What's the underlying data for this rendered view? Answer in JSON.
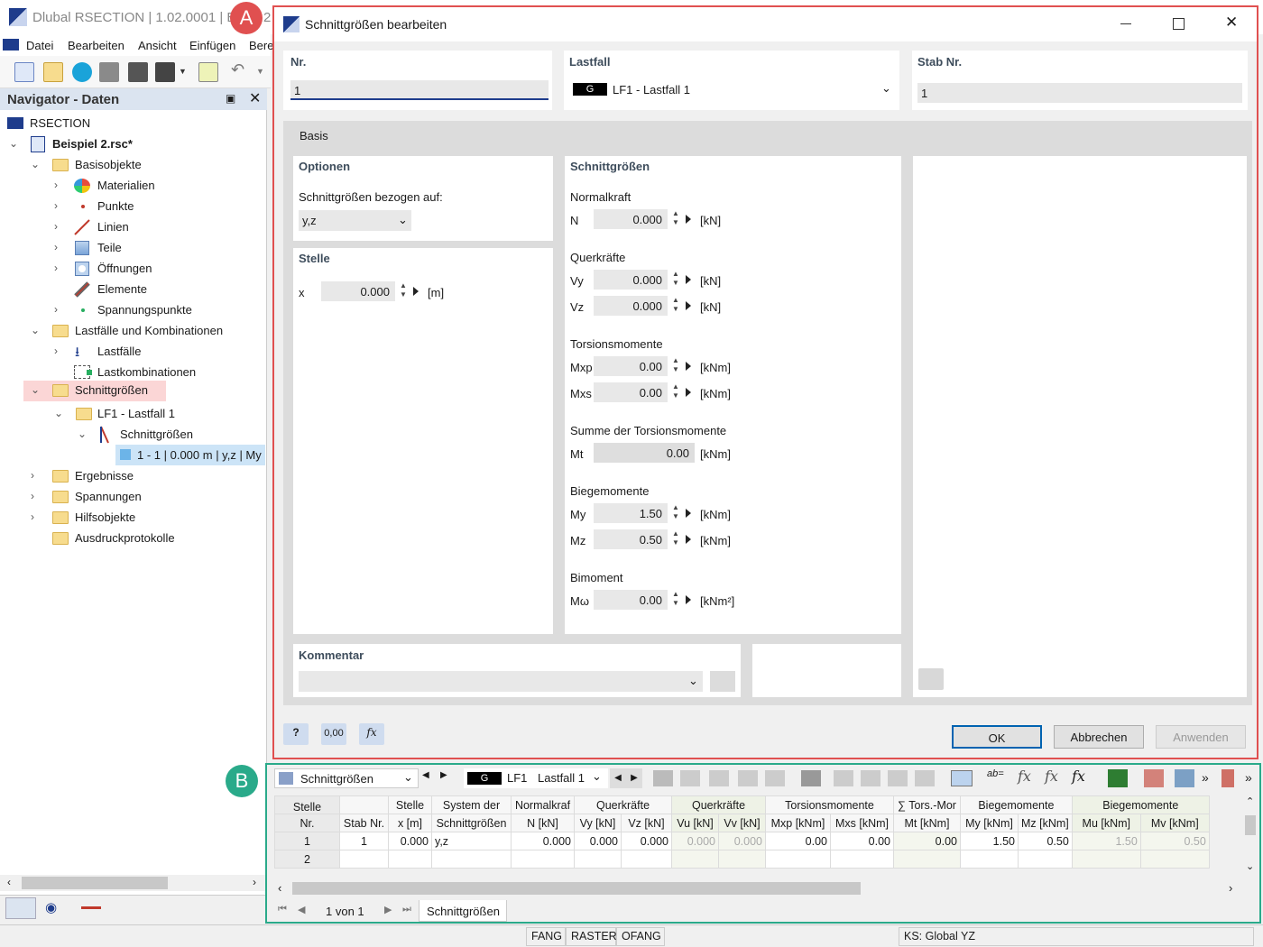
{
  "app": {
    "title": "Dlubal RSECTION | 1.02.0001 | Be",
    "title_suffix": "2"
  },
  "menu": [
    "Datei",
    "Bearbeiten",
    "Ansicht",
    "Einfügen",
    "Bere"
  ],
  "navigator": {
    "title": "Navigator - Daten",
    "root": "RSECTION",
    "file": "Beispiel 2.rsc*",
    "items": {
      "basisobjekte": "Basisobjekte",
      "materialien": "Materialien",
      "punkte": "Punkte",
      "linien": "Linien",
      "teile": "Teile",
      "oeffnungen": "Öffnungen",
      "elemente": "Elemente",
      "spannungspunkte": "Spannungspunkte",
      "lastfaelle_komb": "Lastfälle und Kombinationen",
      "lastfaelle": "Lastfälle",
      "lastkombinationen": "Lastkombinationen",
      "schnittgroessen": "Schnittgrößen",
      "lf1": "LF1 - Lastfall 1",
      "schnittgroessen_sub": "Schnittgrößen",
      "entry": "1 - 1 | 0.000 m | y,z | My",
      "ergebnisse": "Ergebnisse",
      "spannungen": "Spannungen",
      "hilfsobjekte": "Hilfsobjekte",
      "ausdruck": "Ausdruckprotokolle"
    }
  },
  "dialog": {
    "title": "Schnittgrößen bearbeiten",
    "nr_label": "Nr.",
    "nr_value": "1",
    "lastfall_label": "Lastfall",
    "lastfall_badge": "G",
    "lastfall_value": "LF1 - Lastfall 1",
    "stab_label": "Stab Nr.",
    "stab_value": "1",
    "tab": "Basis",
    "optionen": "Optionen",
    "bezogen_label": "Schnittgrößen bezogen auf:",
    "bezogen_value": "y,z",
    "stelle": "Stelle",
    "x_label": "x",
    "x_value": "0.000",
    "x_unit": "[m]",
    "schnitt_title": "Schnittgrößen",
    "normalkraft": "Normalkraft",
    "N": "N",
    "N_val": "0.000",
    "kN": "[kN]",
    "querkraefte": "Querkräfte",
    "Vy": "Vy",
    "Vy_val": "0.000",
    "Vz": "Vz",
    "Vz_val": "0.000",
    "torsion": "Torsionsmomente",
    "Mxp": "Mxp",
    "Mxp_val": "0.00",
    "kNm": "[kNm]",
    "Mxs": "Mxs",
    "Mxs_val": "0.00",
    "summe": "Summe der Torsionsmomente",
    "Mt": "Mt",
    "Mt_val": "0.00",
    "biege": "Biegemomente",
    "My": "My",
    "My_val": "1.50",
    "Mz": "Mz",
    "Mz_val": "0.50",
    "bimoment": "Bimoment",
    "Mw": "Mω",
    "Mw_val": "0.00",
    "kNm2": "[kNm²]",
    "kommentar": "Kommentar",
    "ok": "OK",
    "abbrechen": "Abbrechen",
    "anwenden": "Anwenden",
    "decimal_icon": "0,00"
  },
  "table": {
    "selector": "Schnittgrößen",
    "lf_badge": "G",
    "lf_short": "LF1",
    "lf_name": "Lastfall 1",
    "headers_top": [
      "Stelle",
      "Stelle",
      "System der",
      "Normalkraf",
      "Querkräfte",
      "Querkräfte",
      "Torsionsmomente",
      "∑ Tors.-Mor",
      "Biegemomente",
      "Biegemomente"
    ],
    "headers_bottom": [
      "Nr.",
      "Stab Nr.",
      "x [m]",
      "Schnittgrößen",
      "N [kN]",
      "Vy [kN]",
      "Vz [kN]",
      "Vu [kN]",
      "Vv [kN]",
      "Mxp [kNm]",
      "Mxs [kNm]",
      "Mt [kNm]",
      "My [kNm]",
      "Mz [kNm]",
      "Mu [kNm]",
      "Mv [kNm]"
    ],
    "rows": [
      [
        "1",
        "1",
        "0.000",
        "y,z",
        "0.000",
        "0.000",
        "0.000",
        "0.000",
        "0.000",
        "0.00",
        "0.00",
        "0.00",
        "1.50",
        "0.50",
        "1.50",
        "0.50"
      ],
      [
        "2",
        "",
        "",
        "",
        "",
        "",
        "",
        "",
        "",
        "",
        "",
        "",
        "",
        "",
        "",
        ""
      ]
    ],
    "pager": "1 von 1",
    "sheet_tab": "Schnittgrößen"
  },
  "status": [
    "FANG",
    "RASTER",
    "OFANG",
    "KS: Global YZ"
  ],
  "markers": {
    "a": "A",
    "b": "B"
  },
  "colors": {
    "red_frame": "#e05050",
    "green_frame": "#2aaa8a",
    "highlight": "#fbd6d6",
    "selected": "#cce4f7"
  }
}
